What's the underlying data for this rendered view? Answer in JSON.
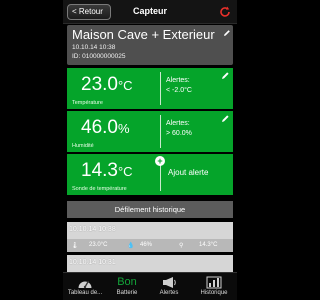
{
  "nav": {
    "back_label": "< Retour",
    "title": "Capteur"
  },
  "header": {
    "name": "Maison Cave + Exterieur",
    "datetime": "10.10.14   10:38",
    "id": "ID: 010000000025"
  },
  "cards": [
    {
      "value": "23.0",
      "unit": "°C",
      "label": "Température",
      "alert_title": "Alertes:",
      "alert_value": "< -2.0°C"
    },
    {
      "value": "46.0",
      "unit": "%",
      "label": "Humidité",
      "alert_title": "Alertes:",
      "alert_value": "> 60.0%"
    },
    {
      "value": "14.3",
      "unit": "°C",
      "label": "Sonde de température",
      "add_alert": "Ajout alerte"
    }
  ],
  "history": {
    "button": "Défilement historique",
    "entries": [
      {
        "datetime": "10.10.14   10:38",
        "temp": "23.0°C",
        "humidity": "46%",
        "probe": "14.3°C"
      },
      {
        "datetime": "10.10.14   10:31"
      }
    ]
  },
  "tabs": [
    {
      "label": "Tableau de...",
      "icon": "dashboard-icon"
    },
    {
      "label": "Batterie",
      "status": "Bon"
    },
    {
      "label": "Alertes",
      "icon": "megaphone-icon"
    },
    {
      "label": "Historique",
      "icon": "bar-chart-icon"
    }
  ],
  "colors": {
    "green": "#05a42a",
    "header": "#4f4f4f",
    "refresh": "#e8302a"
  }
}
